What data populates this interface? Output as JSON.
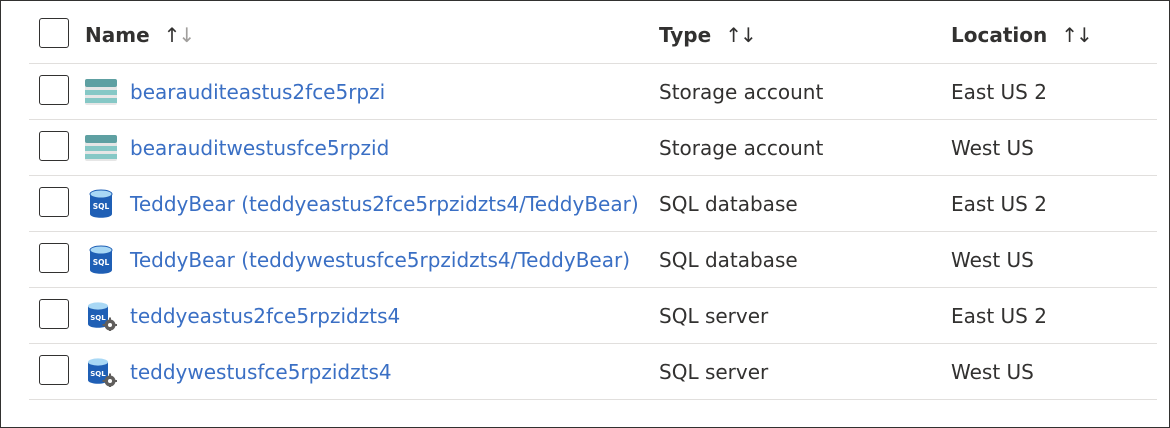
{
  "header": {
    "name": "Name",
    "type": "Type",
    "location": "Location",
    "sort_up": "↑",
    "sort_down": "↓"
  },
  "rows": [
    {
      "name": "bearauditeastus2fce5rpzi",
      "type": "Storage account",
      "location": "East US 2",
      "icon": "storage-account-icon"
    },
    {
      "name": "bearauditwestusfce5rpzid",
      "type": "Storage account",
      "location": "West US",
      "icon": "storage-account-icon"
    },
    {
      "name": "TeddyBear (teddyeastus2fce5rpzidzts4/TeddyBear)",
      "type": "SQL database",
      "location": "East US 2",
      "icon": "sql-database-icon"
    },
    {
      "name": "TeddyBear (teddywestusfce5rpzidzts4/TeddyBear)",
      "type": "SQL database",
      "location": "West US",
      "icon": "sql-database-icon"
    },
    {
      "name": "teddyeastus2fce5rpzidzts4",
      "type": "SQL server",
      "location": "East US 2",
      "icon": "sql-server-icon"
    },
    {
      "name": "teddywestusfce5rpzidzts4",
      "type": "SQL server",
      "location": "West US",
      "icon": "sql-server-icon"
    }
  ],
  "icons": {
    "sql_label": "SQL"
  },
  "colors": {
    "link": "#3a6fc4",
    "storage_top": "#5ea0a2",
    "storage_mid": "#e6e6e6",
    "storage_band": "#86c8c6",
    "sql_body": "#1f5fb5",
    "sql_top": "#a9d8f5"
  }
}
